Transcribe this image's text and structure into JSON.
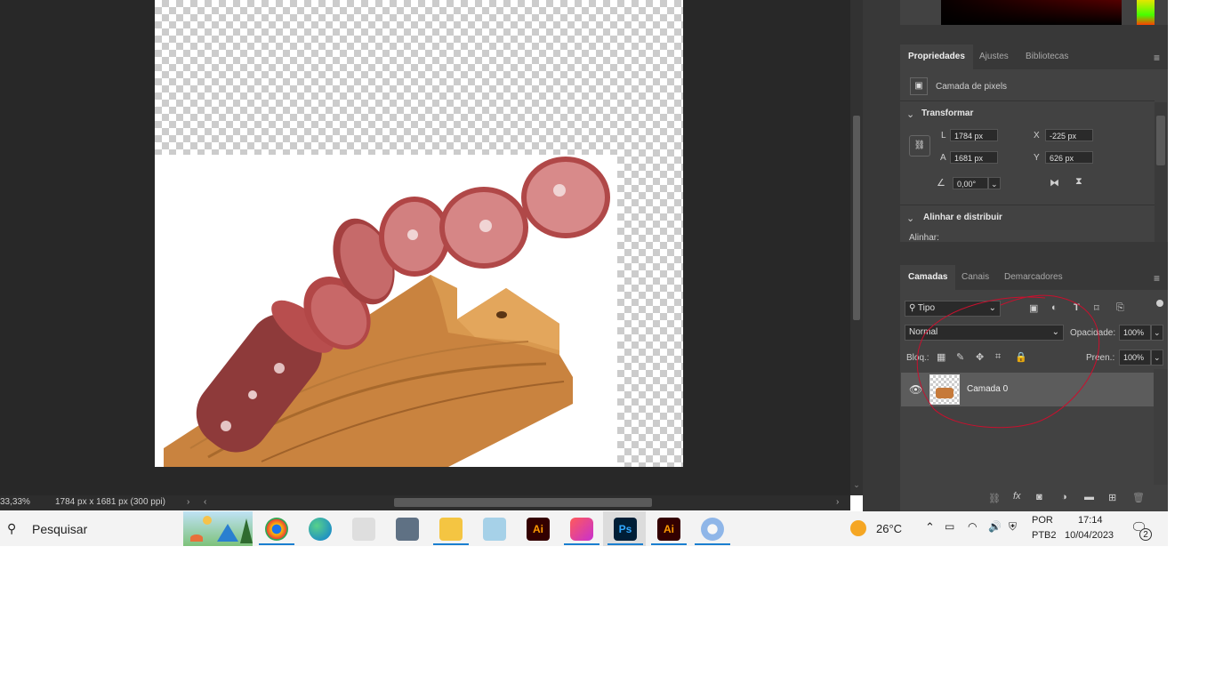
{
  "document": {
    "zoom": "33,33%",
    "dimensions": "1784 px x 1681 px (300 ppi)"
  },
  "properties_panel": {
    "tabs": [
      "Propriedades",
      "Ajustes",
      "Bibliotecas"
    ],
    "layer_kind": "Camada de pixels",
    "transform": {
      "title": "Transformar",
      "w_label": "L",
      "w_value": "1784 px",
      "h_label": "A",
      "h_value": "1681 px",
      "x_label": "X",
      "x_value": "-225 px",
      "y_label": "Y",
      "y_value": "626 px",
      "angle_value": "0,00°"
    },
    "align": {
      "title": "Alinhar e distribuir",
      "label": "Alinhar:"
    }
  },
  "layers_panel": {
    "tabs": [
      "Camadas",
      "Canais",
      "Demarcadores"
    ],
    "filter_kind": "Tipo",
    "blend_mode": "Normal",
    "opacity_label": "Opacidade:",
    "opacity_value": "100%",
    "lock_label": "Bloq.:",
    "fill_label": "Preen.:",
    "fill_value": "100%",
    "layers": [
      {
        "name": "Camada 0",
        "visible": true
      }
    ]
  },
  "taskbar": {
    "search_placeholder": "Pesquisar",
    "weather": "26°C",
    "language_1": "POR",
    "language_2": "PTB2",
    "time": "17:14",
    "date": "10/04/2023",
    "notifications": "2",
    "apps": [
      "chrome-icon",
      "edge-icon",
      "app-icon",
      "calculator-icon",
      "file-explorer-icon",
      "notepad-icon",
      "illustrator-icon",
      "creative-cloud-icon",
      "photoshop-icon",
      "illustrator-icon",
      "paint-icon"
    ],
    "ps_label": "Ps",
    "ai_label": "Ai"
  },
  "colors": {
    "workspace": "#282828",
    "panel": "#424242",
    "accent": "#1a7fd0",
    "annotation": "#c8102e"
  }
}
